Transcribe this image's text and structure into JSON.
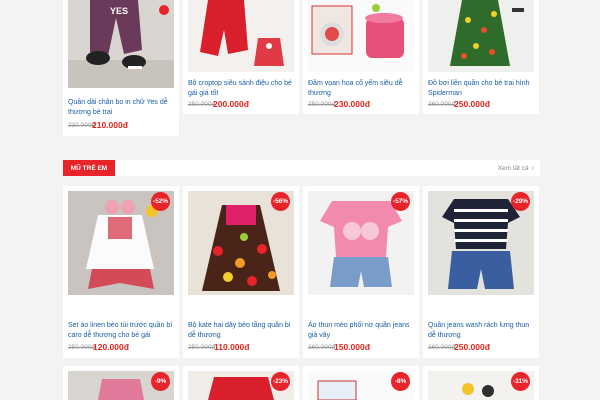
{
  "section": {
    "title": "MŨ TRẺ EM",
    "more_label": "Xem tất cả",
    "more_icon": "chevron-right-icon"
  },
  "top_products": [
    {
      "title": "Quần dài chân bo in chữ Yes dễ thương bé trai",
      "old_price": "230.000đ",
      "price": "210.000đ"
    },
    {
      "title": "Bộ croptop siêu sành điệu cho bé gái giá tốt",
      "old_price": "250.000đ",
      "price": "200.000đ"
    },
    {
      "title": "Đầm voan hoa cổ yếm siêu dễ thương",
      "old_price": "250.000đ",
      "price": "230.000đ"
    },
    {
      "title": "Đồ bơi liền quần cho bé trai hình Spiderman",
      "old_price": "360.000đ",
      "price": "250.000đ"
    }
  ],
  "products": [
    {
      "title": "Set áo linen bèo túi trước quần bí caro dễ thương cho bé gái",
      "old_price": "250.000đ",
      "price": "120.000đ",
      "discount": "-52%"
    },
    {
      "title": "Bộ kate hai dây bèo tầng quần bí dễ thương",
      "old_price": "250.000đ",
      "price": "110.000đ",
      "discount": "-56%"
    },
    {
      "title": "Áo thun mèo phối nơ quần jeans giá vây",
      "old_price": "360.000đ",
      "price": "150.000đ",
      "discount": "-57%"
    },
    {
      "title": "Quần jeans wash rách lưng thun dễ thương",
      "old_price": "360.000đ",
      "price": "250.000đ",
      "discount": "-29%"
    }
  ],
  "bottom_products": [
    {
      "discount": "-9%"
    },
    {
      "discount": "-23%"
    },
    {
      "discount": "-8%"
    },
    {
      "discount": "-31%"
    }
  ],
  "colors": {
    "accent": "#e8232a",
    "price": "#e1251b",
    "title": "#1a5fa8"
  }
}
